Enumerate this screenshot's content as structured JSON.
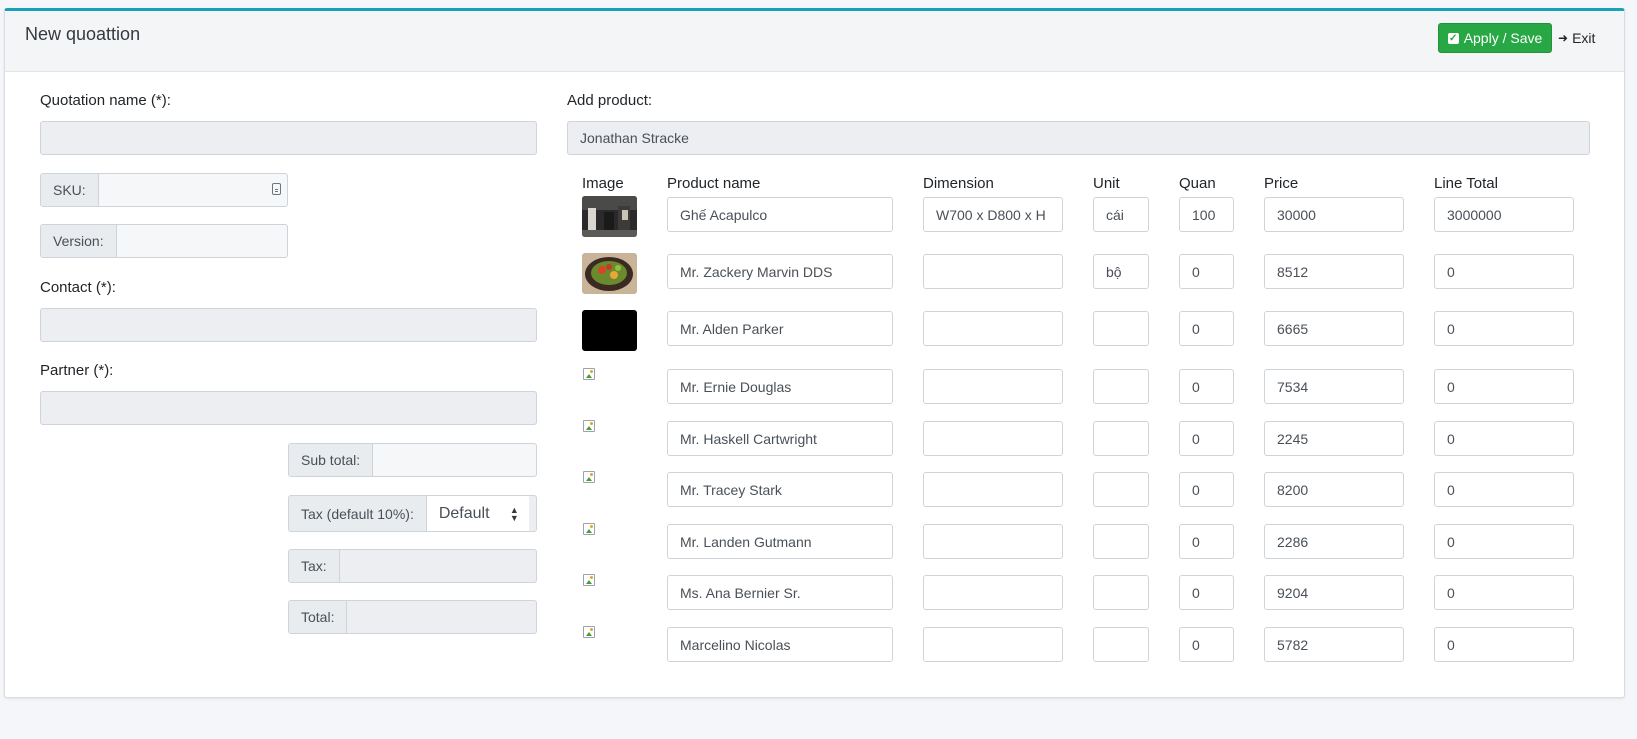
{
  "header": {
    "title": "New quoattion",
    "save_label": "Apply / Save",
    "exit_label": "Exit"
  },
  "form": {
    "quotation_name_label": "Quotation name (*):",
    "quotation_name_value": "",
    "sku_label": "SKU:",
    "sku_value": "",
    "version_label": "Version:",
    "version_value": "",
    "contact_label": "Contact (*):",
    "contact_value": "",
    "partner_label": "Partner (*):",
    "partner_value": ""
  },
  "totals": {
    "subtotal_label": "Sub total:",
    "subtotal_value": "",
    "tax_default_label": "Tax (default 10%):",
    "tax_select_value": "Default",
    "tax_label": "Tax:",
    "tax_value": "",
    "total_label": "Total:",
    "total_value": ""
  },
  "products": {
    "add_label": "Add product:",
    "add_value": "Jonathan Stracke",
    "columns": [
      "Image",
      "Product name",
      "Dimension",
      "Unit",
      "Quan",
      "Price",
      "Line Total"
    ],
    "rows": [
      {
        "image": "photo-chairs",
        "name": "Ghế Acapulco",
        "dimension": "W700 x D800 x H",
        "unit": "cái",
        "quan": "100",
        "price": "30000",
        "total": "3000000"
      },
      {
        "image": "photo-food-bowl",
        "name": "Mr. Zackery Marvin DDS",
        "dimension": "",
        "unit": "bộ",
        "quan": "0",
        "price": "8512",
        "total": "0"
      },
      {
        "image": "photo-black",
        "name": "Mr. Alden Parker",
        "dimension": "",
        "unit": "",
        "quan": "0",
        "price": "6665",
        "total": "0"
      },
      {
        "image": "broken-image-icon",
        "name": "Mr. Ernie Douglas",
        "dimension": "",
        "unit": "",
        "quan": "0",
        "price": "7534",
        "total": "0"
      },
      {
        "image": "broken-image-icon",
        "name": "Mr. Haskell Cartwright",
        "dimension": "",
        "unit": "",
        "quan": "0",
        "price": "2245",
        "total": "0"
      },
      {
        "image": "broken-image-icon",
        "name": "Mr. Tracey Stark",
        "dimension": "",
        "unit": "",
        "quan": "0",
        "price": "8200",
        "total": "0"
      },
      {
        "image": "broken-image-icon",
        "name": "Mr. Landen Gutmann",
        "dimension": "",
        "unit": "",
        "quan": "0",
        "price": "2286",
        "total": "0"
      },
      {
        "image": "broken-image-icon",
        "name": "Ms. Ana Bernier Sr.",
        "dimension": "",
        "unit": "",
        "quan": "0",
        "price": "9204",
        "total": "0"
      },
      {
        "image": "broken-image-icon",
        "name": "Marcelino Nicolas",
        "dimension": "",
        "unit": "",
        "quan": "0",
        "price": "5782",
        "total": "0"
      }
    ]
  },
  "colors": {
    "accent_top": "#17a2b8",
    "save_button": "#28a745"
  }
}
